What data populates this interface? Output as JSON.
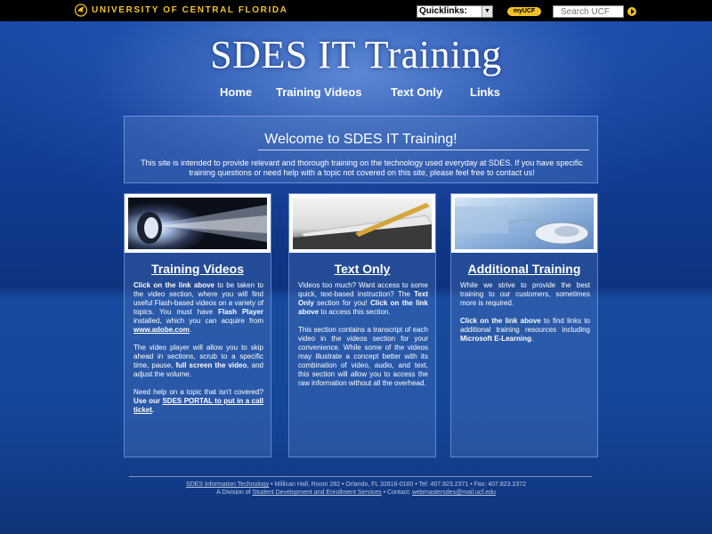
{
  "topbar": {
    "university_name": "UNIVERSITY OF CENTRAL FLORIDA",
    "quicklinks_label": "Quicklinks:",
    "myucf_label": "myUCF",
    "search_placeholder": "Search UCF"
  },
  "site_title": "SDES IT Training",
  "nav": {
    "items": [
      "Home",
      "Training Videos",
      "Text Only",
      "Links"
    ]
  },
  "welcome": {
    "heading": "Welcome to SDES IT Training!",
    "text": "This site is intended to provide relevant and thorough training on the technology used everyday at SDES. If you have specific training questions or need help with a topic not covered on this site, please feel free to contact us!"
  },
  "columns": [
    {
      "title": "Training Videos",
      "p1_lead": "Click on the link above",
      "p1_text_a": " to be taken to the video section, where you will find useful Flash-based videos on a variety of topics. You must have ",
      "p1_bold": "Flash Player",
      "p1_text_b": " installed, which you can acquire from ",
      "p1_link": "www.adobe.com",
      "p1_end": ".",
      "p2_text_a": "The video player will allow you to skip ahead in sections, scrub to a specific time, pause, ",
      "p2_bold": "full screen the video",
      "p2_text_b": ", and adjust the volume.",
      "p3_text": "Need help on a topic that isn't covered? ",
      "p3_bold": "Use our ",
      "p3_link": "SDES PORTAL to put in a call ticket",
      "p3_end": "."
    },
    {
      "title": "Text Only",
      "p1_text_a": "Videos too much? Want access to some quick, text-based instruction? The ",
      "p1_bold": "Text Only",
      "p1_text_b": " section for you! ",
      "p1_bold2": "Click on the link above",
      "p1_end": " to access this section.",
      "p2_text": "This section contains a transcript of each video in the videos section for your convenience. While some of the videos may illustrate a concept better with its combination of video, audio, and text, this section will allow you to access the raw information without all the overhead."
    },
    {
      "title": "Additional Training",
      "p1_text": "While we strive to provide the best training to our customers, sometimes more is required.",
      "p2_bold": "Click on the link above",
      "p2_text_a": " to find links to additional training resources including ",
      "p2_bold2": "Microsoft E-Learning",
      "p2_end": "."
    }
  ],
  "footer": {
    "line1_link": "SDES Information Technology",
    "line1_text": " • Millican Hall, Room 282 • Orlando, FL 32816-0160 • Tel: 407.823.2371 • Fax: 407.823.2372",
    "line2_text_a": "A Division of ",
    "line2_link": "Student Development and Enrollment Services",
    "line2_text_b": " • Contact: ",
    "line2_email": "webmastersdes@mail.ucf.edu"
  },
  "colors": {
    "ucf_gold": "#f0c22a",
    "background_blue": "#123c92"
  },
  "icons": [
    "pegasus-logo-icon",
    "dropdown-arrow-icon",
    "search-go-icon"
  ]
}
